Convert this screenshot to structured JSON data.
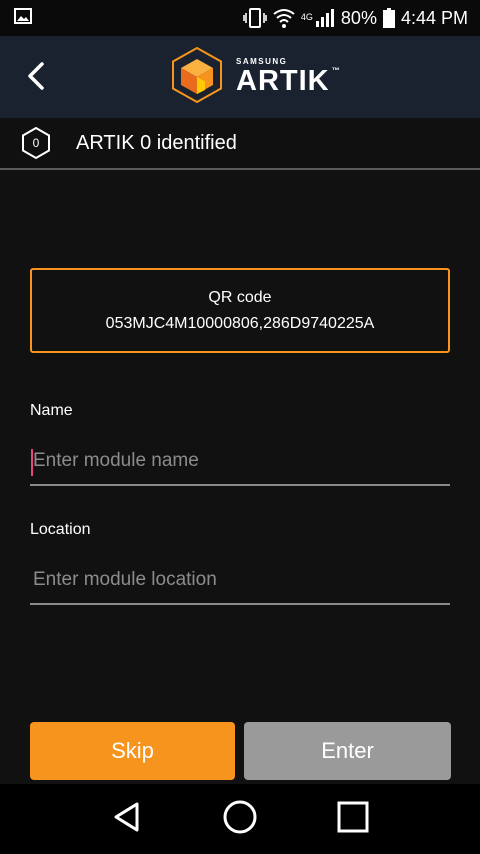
{
  "status_bar": {
    "network_label": "4G",
    "battery_percent": "80%",
    "time": "4:44 PM",
    "icons": [
      "image-icon",
      "vibrate-icon",
      "wifi-icon",
      "signal-icon",
      "battery-icon"
    ]
  },
  "header": {
    "logo_small": "SAMSUNG",
    "logo_big": "ARTIK",
    "logo_tm": "™",
    "back_icon": "chevron-left-icon"
  },
  "identified": {
    "count": "0",
    "text": "ARTIK 0 identified"
  },
  "qr": {
    "title": "QR code",
    "value": "053MJC4M10000806,286D9740225A"
  },
  "form": {
    "name_label": "Name",
    "name_placeholder": "Enter module name",
    "name_value": "",
    "location_label": "Location",
    "location_placeholder": "Enter module location",
    "location_value": ""
  },
  "buttons": {
    "skip": "Skip",
    "enter": "Enter"
  },
  "colors": {
    "accent": "#f7941d",
    "header_bg": "#1a2230",
    "background": "#111111",
    "disabled_button": "#9a9a9a",
    "caret": "#e8457a"
  }
}
